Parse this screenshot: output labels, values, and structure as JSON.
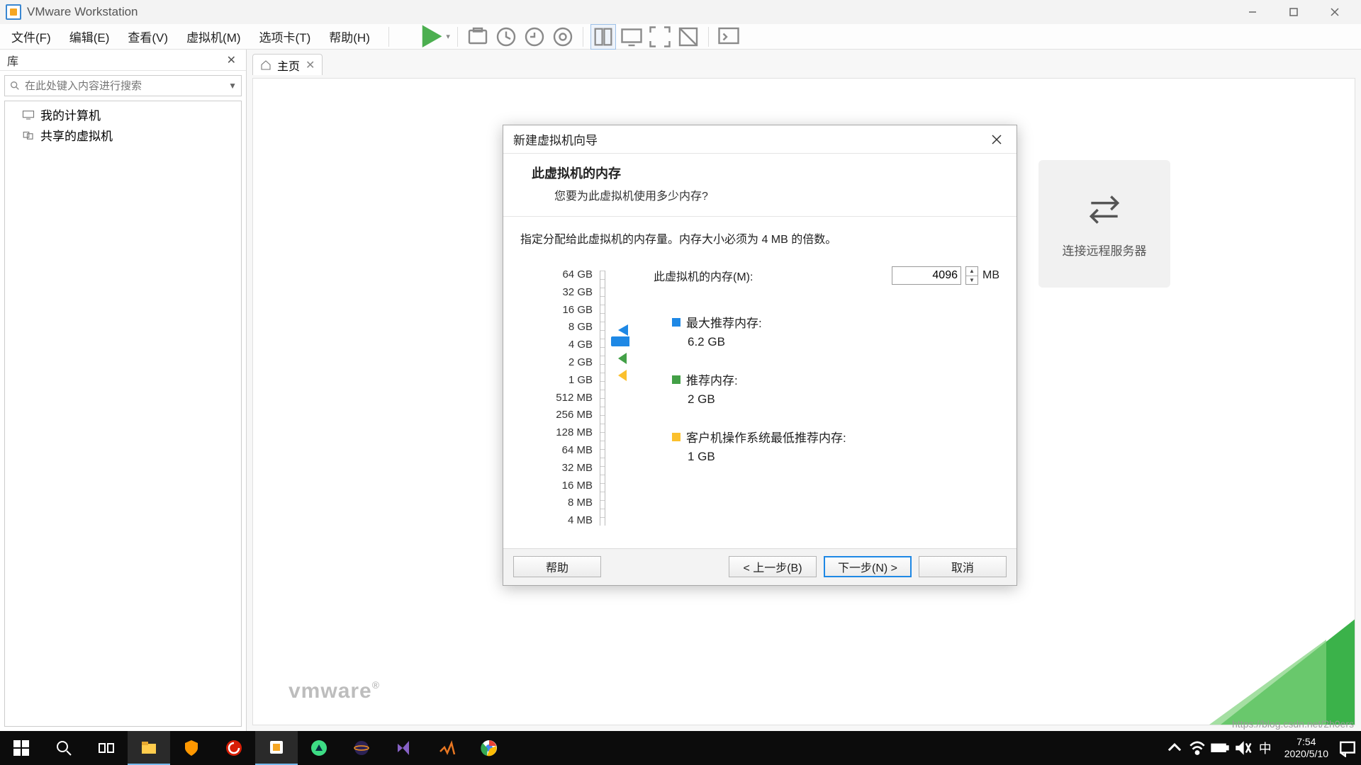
{
  "title_bar": {
    "app_title": "VMware Workstation"
  },
  "menu": {
    "file": "文件(F)",
    "edit": "编辑(E)",
    "view": "查看(V)",
    "vm": "虚拟机(M)",
    "tabs": "选项卡(T)",
    "help": "帮助(H)"
  },
  "library": {
    "header": "库",
    "search_placeholder": "在此处键入内容进行搜索",
    "item_my_computer": "我的计算机",
    "item_shared": "共享的虚拟机"
  },
  "tab": {
    "home": "主页"
  },
  "remote_tile": {
    "label": "连接远程服务器"
  },
  "brand": {
    "text": "vmware"
  },
  "dialog": {
    "title": "新建虚拟机向导",
    "heading": "此虚拟机的内存",
    "subheading": "您要为此虚拟机使用多少内存?",
    "instruction": "指定分配给此虚拟机的内存量。内存大小必须为 4 MB 的倍数。",
    "mem_field_label": "此虚拟机的内存(M):",
    "mem_value": "4096",
    "mem_unit": "MB",
    "ticks": [
      "64 GB",
      "32 GB",
      "16 GB",
      "8 GB",
      "4 GB",
      "2 GB",
      "1 GB",
      "512 MB",
      "256 MB",
      "128 MB",
      "64 MB",
      "32 MB",
      "16 MB",
      "8 MB",
      "4 MB"
    ],
    "max_label": "最大推荐内存:",
    "max_value": "6.2 GB",
    "rec_label": "推荐内存:",
    "rec_value": "2 GB",
    "min_label": "客户机操作系统最低推荐内存:",
    "min_value": "1 GB",
    "help_btn": "帮助",
    "back_btn": "< 上一步(B)",
    "next_btn": "下一步(N) >",
    "cancel_btn": "取消"
  },
  "taskbar": {
    "time": "7:54",
    "date": "2020/5/10",
    "ime": "中"
  },
  "watermark": "https://blog.csdn.net/2h0ers"
}
